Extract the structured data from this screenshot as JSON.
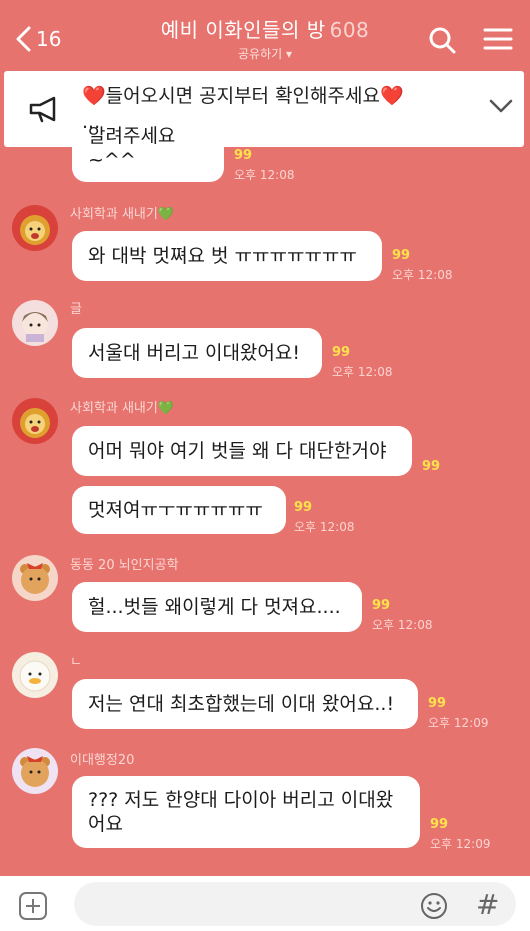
{
  "header": {
    "back_count": "16",
    "title": "예비 이화인들의 방",
    "member_count": "608",
    "subtitle": "공유하기 ▾"
  },
  "notice": {
    "heart_left": "❤️",
    "text": "들어오시면 공지부터 확인해주세요",
    "heart_right": "❤️",
    "ellipsis": "..."
  },
  "messages": [
    {
      "text": "알려주세요~^^",
      "unread": "99",
      "time": "오후 12:08"
    },
    {
      "sender": "사회학과 새내기",
      "sender_heart": "💚",
      "text": "와 대박 멋쪄요 벗 ㅠㅠㅠㅠㅠㅠㅠ",
      "unread": "99",
      "time": "오후 12:08"
    },
    {
      "sender": "글",
      "text": "서울대 버리고 이대왔어요!",
      "unread": "99",
      "time": "오후 12:08"
    },
    {
      "sender": "사회학과 새내기",
      "sender_heart": "💚",
      "text": "어머 뭐야 여기 벗들 왜 다 대단한거야",
      "unread": "99"
    },
    {
      "text": "멋져여ㅠㅜㅠㅠㅠㅠㅠ",
      "unread": "99",
      "time": "오후 12:08"
    },
    {
      "sender": "동동 20 뇌인지공학",
      "text": "헐...벗들 왜이렇게 다 멋져요....",
      "unread": "99",
      "time": "오후 12:08"
    },
    {
      "sender": "ㄴ",
      "text": "저는 연대 최초합했는데 이대 왔어요..!",
      "unread": "99",
      "time": "오후 12:09"
    },
    {
      "sender": "이대행정20",
      "text_line1": "??? 저도 한양대 다이아 버리고 이대왔",
      "text_line2": "어요",
      "unread": "99",
      "time": "오후 12:09"
    }
  ],
  "colors": {
    "background": "#e7736f",
    "unread": "#ffe24a",
    "bubble": "#ffffff"
  },
  "input_bar": {
    "placeholder": "",
    "hash": "#"
  }
}
